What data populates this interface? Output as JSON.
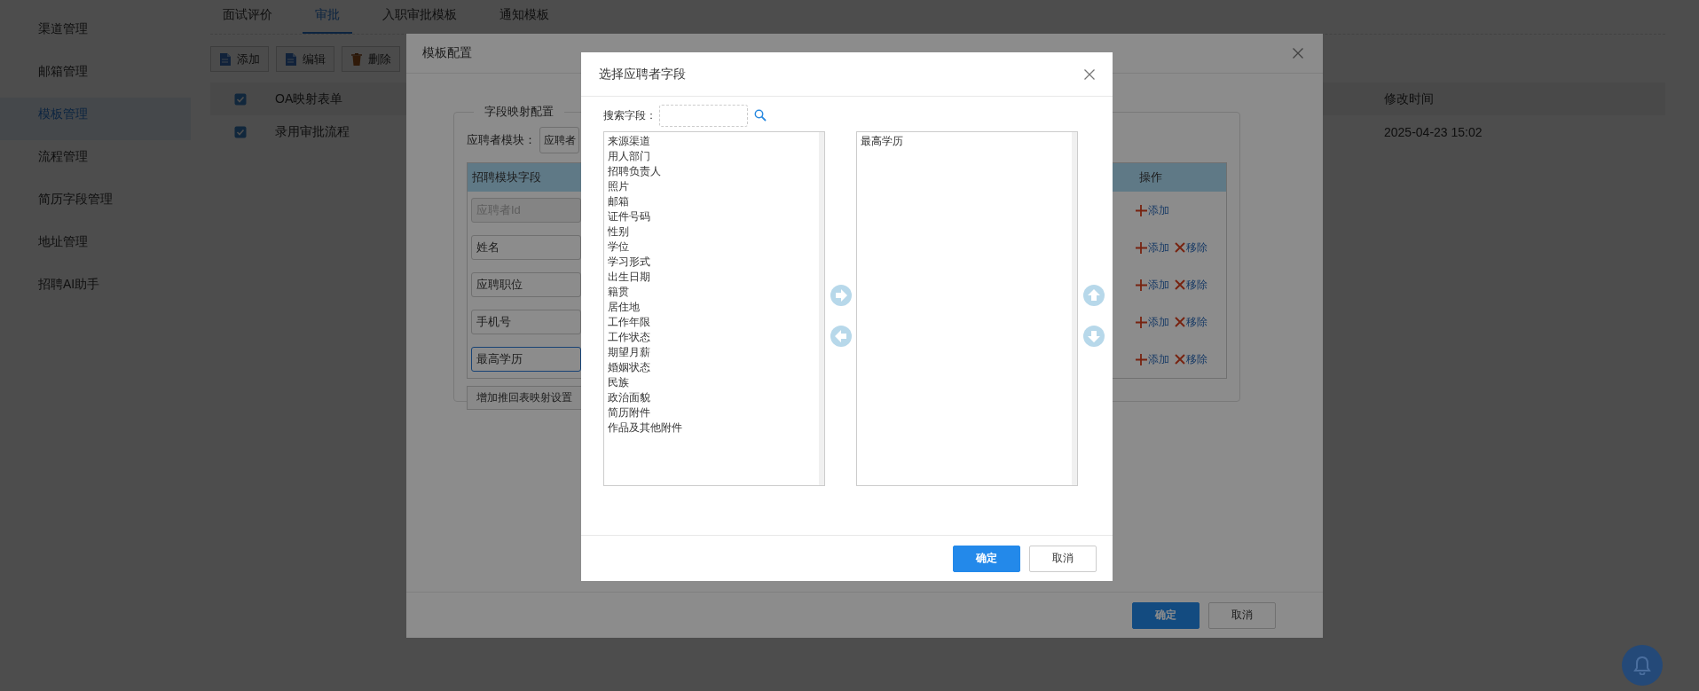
{
  "sidebar": {
    "items": [
      {
        "label": "渠道管理",
        "selected": false
      },
      {
        "label": "邮箱管理",
        "selected": false
      },
      {
        "label": "模板管理",
        "selected": true
      },
      {
        "label": "流程管理",
        "selected": false
      },
      {
        "label": "简历字段管理",
        "selected": false
      },
      {
        "label": "地址管理",
        "selected": false
      },
      {
        "label": "招聘AI助手",
        "selected": false
      }
    ]
  },
  "tabs": [
    {
      "label": "面试评价",
      "selected": false
    },
    {
      "label": "审批",
      "selected": true
    },
    {
      "label": "入职审批模板",
      "selected": false
    },
    {
      "label": "通知模板",
      "selected": false
    }
  ],
  "toolbar": {
    "buttons": [
      {
        "label": "添加",
        "kind": "document"
      },
      {
        "label": "编辑",
        "kind": "document"
      },
      {
        "label": "删除",
        "kind": "trash"
      }
    ]
  },
  "table": {
    "header": {
      "checked": true,
      "columns": [
        "OA映射表单",
        "修改时间"
      ]
    },
    "rows": [
      {
        "checked": true,
        "cells": [
          "录用审批流程",
          "2025-04-23 15:02"
        ]
      }
    ]
  },
  "template_dialog": {
    "title": "模板配置",
    "fieldset": {
      "legend": "字段映射配置",
      "module_label": "应聘者模块：",
      "module_value": "应聘者",
      "columns": [
        "招聘模块字段",
        "操作"
      ],
      "rows": [
        {
          "field": "应聘者Id",
          "disabled": true,
          "focused": false,
          "actions": [
            {
              "kind": "add",
              "label": "添加"
            }
          ]
        },
        {
          "field": "姓名",
          "disabled": false,
          "focused": false,
          "actions": [
            {
              "kind": "add",
              "label": "添加"
            },
            {
              "kind": "remove",
              "label": "移除"
            }
          ]
        },
        {
          "field": "应聘职位",
          "disabled": false,
          "focused": false,
          "actions": [
            {
              "kind": "add",
              "label": "添加"
            },
            {
              "kind": "remove",
              "label": "移除"
            }
          ]
        },
        {
          "field": "手机号",
          "disabled": false,
          "focused": false,
          "actions": [
            {
              "kind": "add",
              "label": "添加"
            },
            {
              "kind": "remove",
              "label": "移除"
            }
          ]
        },
        {
          "field": "最高学历",
          "disabled": false,
          "focused": true,
          "actions": [
            {
              "kind": "add",
              "label": "添加"
            },
            {
              "kind": "remove",
              "label": "移除"
            }
          ]
        }
      ],
      "add_button": "增加推回表映射设置"
    },
    "buttons": [
      {
        "label": "确定",
        "kind": "primary"
      },
      {
        "label": "取消",
        "kind": "default"
      }
    ]
  },
  "field_picker": {
    "title": "选择应聘者字段",
    "search_label": "搜索字段：",
    "available": [
      "来源渠道",
      "用人部门",
      "招聘负责人",
      "照片",
      "邮箱",
      "证件号码",
      "性别",
      "学位",
      "学习形式",
      "出生日期",
      "籍贯",
      "居住地",
      "工作年限",
      "工作状态",
      "期望月薪",
      "婚姻状态",
      "民族",
      "政治面貌",
      "简历附件",
      "作品及其他附件"
    ],
    "chosen": [
      "最高学历"
    ],
    "buttons": [
      {
        "label": "确定",
        "kind": "primary"
      },
      {
        "label": "取消",
        "kind": "default"
      }
    ]
  }
}
